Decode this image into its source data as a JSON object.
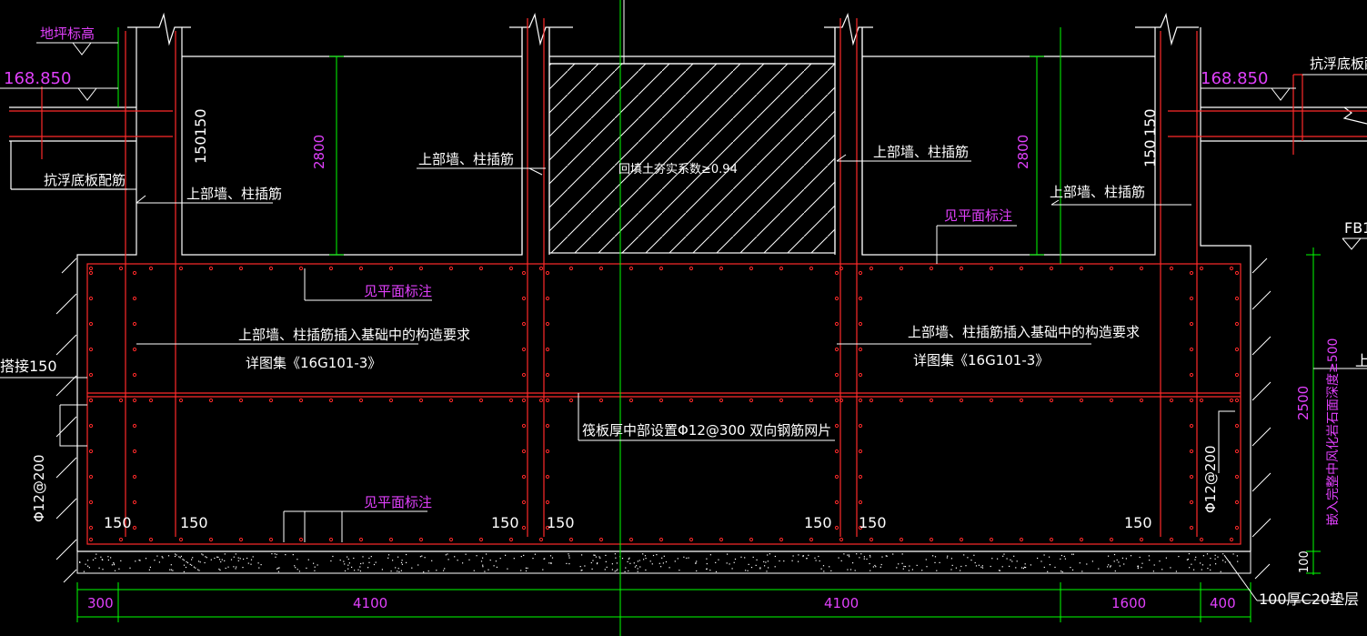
{
  "labels": {
    "ground_elevation": "地坪标高",
    "elev_left": "168.850",
    "elev_right": "168.850",
    "anti_float_left": "抗浮底板配筋",
    "anti_float_right": "抗浮底板配",
    "wall_col_dowel_1": "上部墙、柱插筋",
    "wall_col_dowel_2": "上部墙、柱插筋",
    "wall_col_dowel_3": "上部墙、柱插筋",
    "wall_col_dowel_4": "上部墙、柱插筋",
    "backfill": "回填土夯实系数≥0.94",
    "see_plan_1": "见平面标注",
    "see_plan_2": "见平面标注",
    "see_plan_3": "见平面标注",
    "dowel_req_left": "上部墙、柱插筋插入基础中的构造要求",
    "dowel_req_right": "上部墙、柱插筋插入基础中的构造要求",
    "atlas_left": "详图集《16G101-3》",
    "atlas_right": "详图集《16G101-3》",
    "raft_mesh": "筏板厚中部设置Φ12@300 双向钢筋网片",
    "lap": "搭接150",
    "side_bar_left": "Φ12@200",
    "side_bar_right": "Φ12@200",
    "fb_tag": "FB1",
    "right_cut": "上",
    "embed_depth": "嵌入完整中风化岩石面深度≥500",
    "cushion": "100厚C20垫层"
  },
  "dims": {
    "h2800_left": "2800",
    "h2800_right": "2800",
    "v150a": "150",
    "v150b": "150",
    "v150c": "150",
    "v150d": "150",
    "s150_1": "150",
    "s150_2": "150",
    "s150_3": "150",
    "s150_4": "150",
    "s150_5": "150",
    "s150_6": "150",
    "s150_7": "150",
    "d300": "300",
    "d4100a": "4100",
    "d4100b": "4100",
    "d1600": "1600",
    "d400": "400",
    "d2500": "2500",
    "d100": "100"
  },
  "colors": {
    "background": "#000000",
    "outline": "#ffffff",
    "rebar": "#ff2a2a",
    "dimension": "#00ff00",
    "annotation": "#e040fb"
  }
}
